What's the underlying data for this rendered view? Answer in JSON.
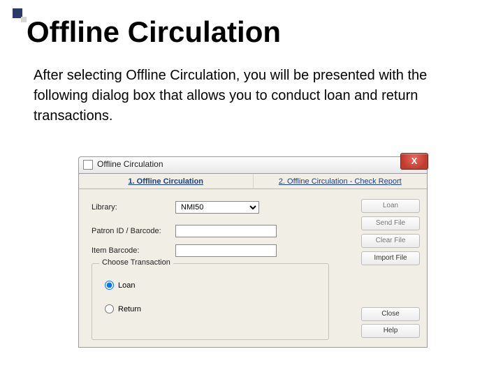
{
  "slide": {
    "title": "Offline Circulation",
    "body": "After selecting Offline Circulation, you will be presented with the following dialog box that allows you to conduct loan and return transactions."
  },
  "dialog": {
    "window_title": "Offline Circulation",
    "tabs": {
      "tab1": "1. Offline Circulation",
      "tab2": "2. Offline Circulation - Check Report"
    },
    "labels": {
      "library": "Library:",
      "patron": "Patron ID / Barcode:",
      "item": "Item Barcode:"
    },
    "values": {
      "library": "NMI50",
      "patron": "",
      "item": ""
    },
    "fieldset": {
      "legend": "Choose Transaction",
      "loan": "Loan",
      "return": "Return"
    },
    "buttons": {
      "loan": "Loan",
      "send_file": "Send File",
      "clear_file": "Clear File",
      "import_file": "Import File",
      "close": "Close",
      "help": "Help"
    }
  }
}
